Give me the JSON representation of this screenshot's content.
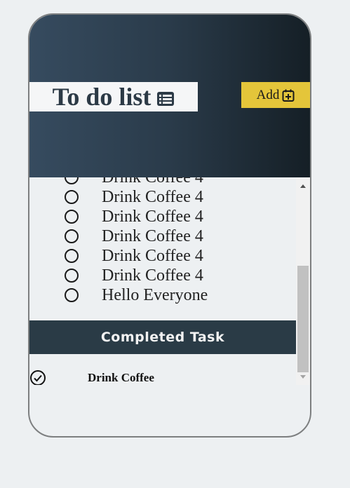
{
  "header": {
    "title": "To do list",
    "title_icon": "list-icon",
    "add_label": "Add",
    "add_icon": "calendar-plus-icon",
    "accent_color": "#e4c53a"
  },
  "tasks": [
    {
      "label": "Drink Coffee 4"
    },
    {
      "label": "Drink Coffee 4"
    },
    {
      "label": "Drink Coffee 4"
    },
    {
      "label": "Drink Coffee 4"
    },
    {
      "label": "Drink Coffee 4"
    },
    {
      "label": "Drink Coffee 4"
    },
    {
      "label": "Hello Everyone"
    }
  ],
  "completed": {
    "heading": "Completed Task",
    "items": [
      {
        "label": "Drink Coffee",
        "icon": "check-circle-icon"
      }
    ]
  }
}
